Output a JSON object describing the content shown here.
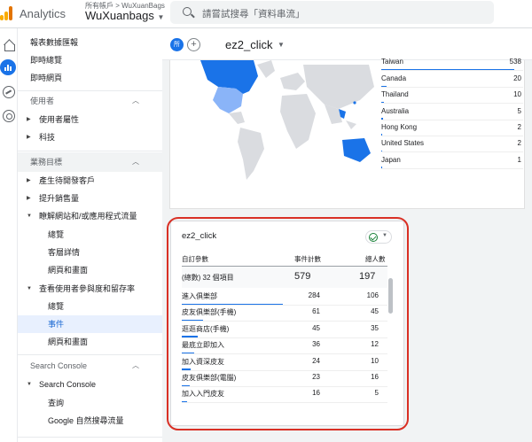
{
  "header": {
    "brand": "Analytics",
    "account_path": "所有帳戶 > WuXuanBags",
    "property": "WuXuanbags",
    "search_placeholder": "請嘗試搜尋「資料串流」"
  },
  "sidebar": {
    "top_items": [
      "報表數據匯報",
      "即時總覽",
      "即時網頁"
    ],
    "section_user": "使用者",
    "user_items": [
      "使用者屬性",
      "科技"
    ],
    "section_business": "業務目標",
    "business_items": [
      "產生待開發客戶",
      "提升銷售量",
      "瞭解網站和/或應用程式流量"
    ],
    "traffic_sub": [
      "總覽",
      "客層詳情",
      "網頁和畫面"
    ],
    "engagement": "查看使用者參與度和留存率",
    "engagement_sub": [
      "總覽",
      "事件",
      "網頁和畫面"
    ],
    "section_search": "Search Console",
    "search_group": "Search Console",
    "search_sub": [
      "查詢",
      "Google 自然搜尋流量"
    ]
  },
  "subheader": {
    "all_chip": "所",
    "add_chip": "+",
    "title": "ez2_click"
  },
  "countries": [
    {
      "name": "Taiwan",
      "value": "538",
      "share": 1.0
    },
    {
      "name": "Canada",
      "value": "20",
      "share": 0.04
    },
    {
      "name": "Thailand",
      "value": "10",
      "share": 0.02
    },
    {
      "name": "Australia",
      "value": "5",
      "share": 0.01
    },
    {
      "name": "Hong Kong",
      "value": "2",
      "share": 0.004
    },
    {
      "name": "United States",
      "value": "2",
      "share": 0.004
    },
    {
      "name": "Japan",
      "value": "1",
      "share": 0.002
    }
  ],
  "events_card": {
    "title": "ez2_click",
    "col_param": "自訂參數",
    "col_count": "事件計數",
    "col_users": "總人數",
    "total_label": "(總數) 32 個項目",
    "total_count": "579",
    "total_users": "197",
    "rows": [
      {
        "name": "進入俱樂部",
        "count": "284",
        "users": "106",
        "share": 0.49
      },
      {
        "name": "皮友俱樂部(手機)",
        "count": "61",
        "users": "45",
        "share": 0.105
      },
      {
        "name": "逛逛商店(手機)",
        "count": "45",
        "users": "35",
        "share": 0.078
      },
      {
        "name": "最底立即加入",
        "count": "36",
        "users": "12",
        "share": 0.062
      },
      {
        "name": "加入資深皮友",
        "count": "24",
        "users": "10",
        "share": 0.041
      },
      {
        "name": "皮友俱樂部(電腦)",
        "count": "23",
        "users": "16",
        "share": 0.04
      },
      {
        "name": "加入入門皮友",
        "count": "16",
        "users": "5",
        "share": 0.028
      }
    ]
  },
  "colors": {
    "accent": "#1a73e8",
    "highlight": "#d93025",
    "success": "#188038"
  }
}
